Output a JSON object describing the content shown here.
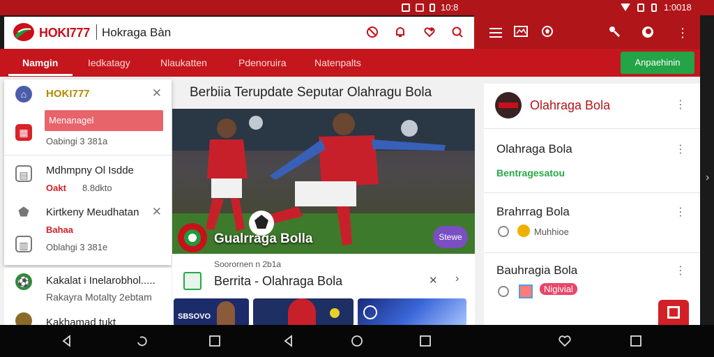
{
  "status_bar": {
    "left_time": "10:8",
    "right_time": "1:0018"
  },
  "header": {
    "brand": "HOKI777",
    "subtitle": "Hokraga Bàn",
    "brand_color": "#c8101a"
  },
  "tabs": [
    {
      "label": "Namgin",
      "active": true
    },
    {
      "label": "Iedkatagy",
      "active": false
    },
    {
      "label": "Nlaukatten",
      "active": false
    },
    {
      "label": "Pdenoruira",
      "active": false
    },
    {
      "label": "Natenpalts",
      "active": false
    }
  ],
  "cta": {
    "label": "Anpaehinin",
    "color": "#22a447"
  },
  "drawer": {
    "title": "HOKI777",
    "highlight": "Menanagel",
    "highlight_sub": "Oabingi 3 381a",
    "items": [
      {
        "title": "Mdhmpny Ol Isdde",
        "tag": "Oakt",
        "sub": "8.8dkto"
      },
      {
        "title": "Kirtkeny Meudhatan",
        "tag": "Bahaa",
        "sub": "Oblahgi 3 381e"
      }
    ]
  },
  "lower_list": {
    "items": [
      {
        "title": "Kakalat i Inelarobhol.....",
        "sub": "Rakayra Motalty 2ebtam"
      },
      {
        "title": "Kakhamad tukt"
      }
    ]
  },
  "main": {
    "headline": "Berbiia Terupdate Seputar Olahragu Bola",
    "hero_caption": "Gualrraga Bolla",
    "hero_badge": "Stewe",
    "article_title": "Berrita - Olahraga Bola",
    "article_meta": "Soorornen n 2b1a",
    "thumb_label": "SBSOVO"
  },
  "right_panel": {
    "title": "Olahraga Bola",
    "rows": [
      {
        "title": "Olahraga Bola",
        "sub": "Bentragesatou"
      },
      {
        "title": "Brahrrag Bola",
        "sub": "Muhhioe"
      },
      {
        "title": "Bauhragia Bola",
        "sub": "Nigivial"
      }
    ],
    "accent": "#b0151a"
  }
}
